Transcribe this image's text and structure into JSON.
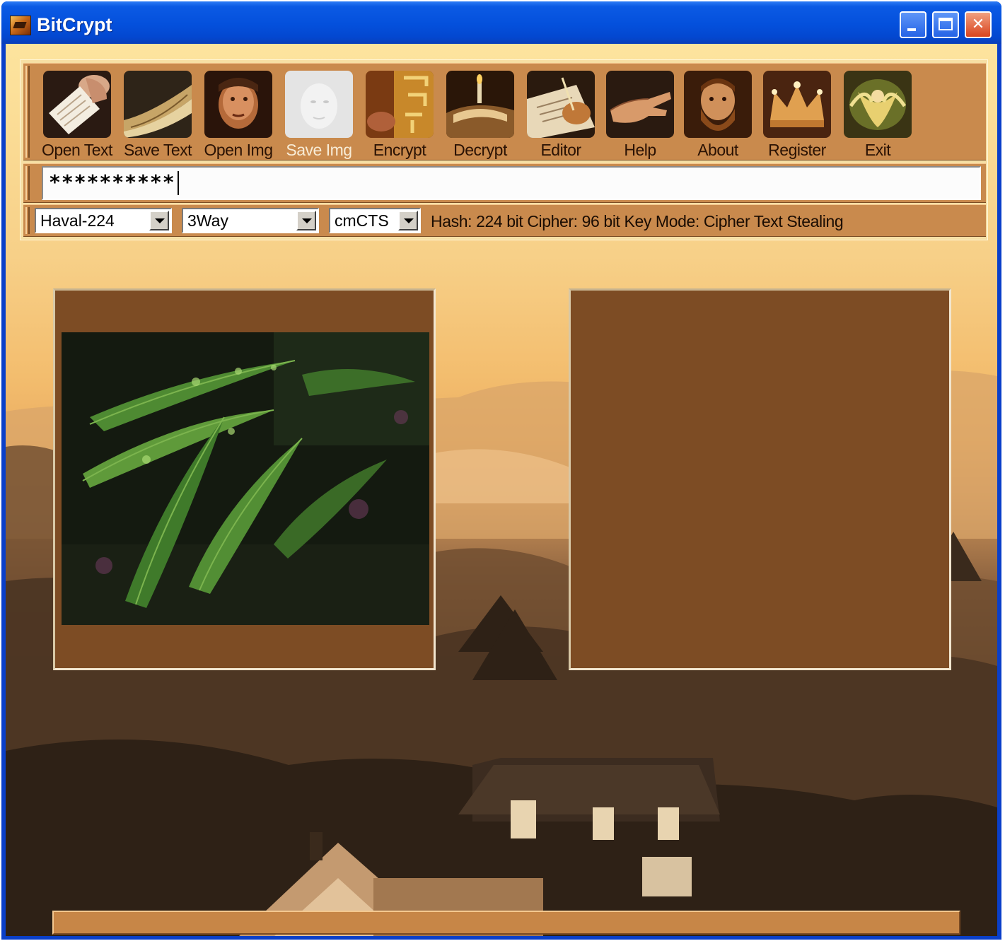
{
  "window": {
    "title": "BitCrypt"
  },
  "toolbar": {
    "buttons": [
      {
        "label": "Open Text",
        "icon": "hand-with-paper-icon",
        "enabled": true
      },
      {
        "label": "Save Text",
        "icon": "scroll-icon",
        "enabled": true
      },
      {
        "label": "Open Img",
        "icon": "rembrandt-portrait-icon",
        "enabled": true
      },
      {
        "label": "Save Img",
        "icon": "faded-portrait-icon",
        "enabled": false
      },
      {
        "label": "Encrypt",
        "icon": "hebrew-script-icon",
        "enabled": true
      },
      {
        "label": "Decrypt",
        "icon": "candle-book-icon",
        "enabled": true
      },
      {
        "label": "Editor",
        "icon": "writing-hand-icon",
        "enabled": true
      },
      {
        "label": "Help",
        "icon": "open-hand-icon",
        "enabled": true
      },
      {
        "label": "About",
        "icon": "bearded-man-portrait-icon",
        "enabled": true
      },
      {
        "label": "Register",
        "icon": "crown-icon",
        "enabled": true
      },
      {
        "label": "Exit",
        "icon": "angel-icon",
        "enabled": true
      }
    ]
  },
  "password": {
    "value": "**********"
  },
  "options": {
    "hash": "Haval-224",
    "cipher": "3Way",
    "mode": "cmCTS",
    "info": "Hash: 224 bit  Cipher: 96 bit Key Mode: Cipher Text Stealing"
  },
  "panels": {
    "left_image": "fern-leaves-photo",
    "right_image": ""
  },
  "progress": {
    "fraction": 1.0
  },
  "colors": {
    "band": "#c98a4d",
    "panel": "#7d4c24",
    "titlebar": "#0450dc"
  }
}
